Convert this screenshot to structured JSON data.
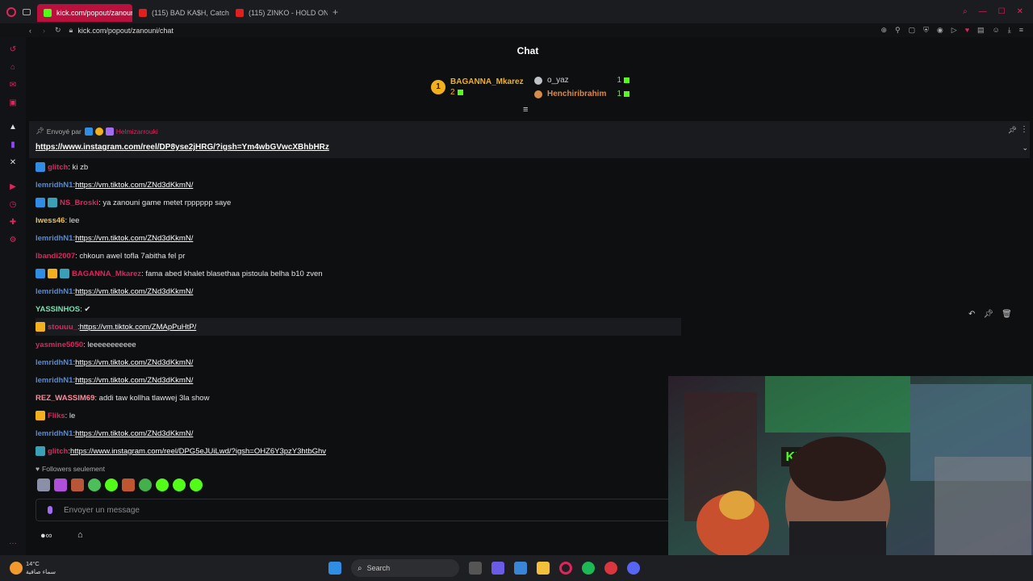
{
  "browser": {
    "tabs": [
      {
        "label": "kick.com/popout/zanouni",
        "active": true
      },
      {
        "label": "(115) BAD KA$H, Catcher",
        "active": false
      },
      {
        "label": "(115) ZINKO - HOLD ON -",
        "active": false
      }
    ],
    "url": "kick.com/popout/zanouni/chat"
  },
  "chat": {
    "title": "Chat",
    "leaders": {
      "first_name": "BAGANNA_Mkarez",
      "first_count": "2",
      "second_name": "o_yaz",
      "second_count": "1",
      "third_name": "Henchiribrahim",
      "third_count": "1"
    },
    "pinned": {
      "sent_by": "Envoyé par",
      "user": "Helmizarrouki",
      "link": "https://www.instagram.com/reel/DP8yse2jHRG/?igsh=Ym4wbGVwcXBhbHRz"
    },
    "messages": [
      {
        "user": "glitch",
        "color": "#e0245e",
        "text": ": ki zb",
        "link": ""
      },
      {
        "user": "lemridhN1",
        "color": "#4b8de8",
        "text": ": ",
        "link": "https://vm.tiktok.com/ZNd3dKkmN/"
      },
      {
        "user": "NS_Broski",
        "color": "#e0245e",
        "text": ": ya zanouni game metet rpppppp saye",
        "link": ""
      },
      {
        "user": "lwess46",
        "color": "#f0c24b",
        "text": ": lee",
        "link": ""
      },
      {
        "user": "lemridhN1",
        "color": "#4b8de8",
        "text": ": ",
        "link": "https://vm.tiktok.com/ZNd3dKkmN/"
      },
      {
        "user": "lbandi2007",
        "color": "#e0245e",
        "text": ": chkoun awel tofla 7abitha fel pr",
        "link": ""
      },
      {
        "user": "BAGANNA_Mkarez",
        "color": "#e0245e",
        "text": ": fama abed khalet blasethaa pistoula belha b10 zven",
        "link": ""
      },
      {
        "user": "lemridhN1",
        "color": "#4b8de8",
        "text": ": ",
        "link": "https://vm.tiktok.com/ZNd3dKkmN/"
      },
      {
        "user": "YASSINHOS",
        "color": "#7be0b2",
        "text": ": ✔",
        "link": ""
      },
      {
        "user": "stouuu_",
        "color": "#e0245e",
        "text": ": ",
        "link": "https://vm.tiktok.com/ZMApPuHtP/"
      },
      {
        "user": "yasmine5050",
        "color": "#e0245e",
        "text": ": leeeeeeeeeee",
        "link": ""
      },
      {
        "user": "lemridhN1",
        "color": "#4b8de8",
        "text": ": ",
        "link": "https://vm.tiktok.com/ZNd3dKkmN/"
      },
      {
        "user": "lemridhN1",
        "color": "#4b8de8",
        "text": ": ",
        "link": "https://vm.tiktok.com/ZNd3dKkmN/"
      },
      {
        "user": "REZ_WASSIM69",
        "color": "#ff8a9a",
        "text": ": addi taw kollha tlawwej 3la show",
        "link": ""
      },
      {
        "user": "Fliks",
        "color": "#e0245e",
        "text": ": le",
        "link": ""
      },
      {
        "user": "lemridhN1",
        "color": "#4b8de8",
        "text": ": ",
        "link": "https://vm.tiktok.com/ZNd3dKkmN/"
      },
      {
        "user": "glitch",
        "color": "#e0245e",
        "text": ": ",
        "link": "https://www.instagram.com/reel/DPG5eJUiLwd/?igsh=OHZ6Y3pzY3htbGhv"
      }
    ],
    "followers_only": "Followers seulement",
    "input_placeholder": "Envoyer un message"
  },
  "taskbar": {
    "weather_temp": "14°C",
    "weather_desc": "سماء صافية",
    "search_label": "Search"
  },
  "colors": {
    "accent": "#53fc18",
    "tab_active": "#b9103d"
  }
}
